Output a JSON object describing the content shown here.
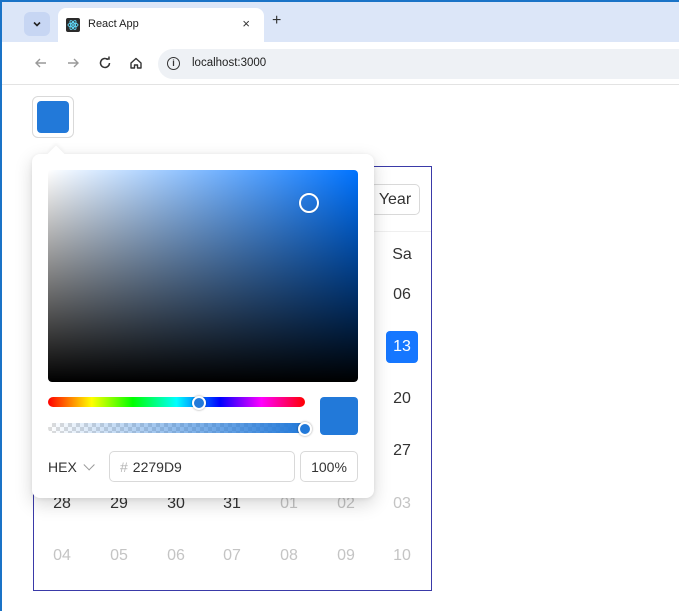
{
  "browser": {
    "tab_title": "React App",
    "tab_close": "×",
    "new_tab": "+",
    "url": "localhost:3000",
    "info_glyph": "i"
  },
  "color_picker": {
    "value_hex": "#2279D9",
    "format": "HEX",
    "hex_prefix": "#",
    "hex_value": "2279D9",
    "alpha": "100%"
  },
  "calendar": {
    "year_button": "Year",
    "weekday_visible": "Sa",
    "cells": [
      {
        "text": "06",
        "state": "cur"
      },
      {
        "text": "13",
        "state": "sel"
      },
      {
        "text": "20",
        "state": "cur"
      },
      {
        "text": "27",
        "state": "cur"
      },
      {
        "text": "28",
        "state": "cur"
      },
      {
        "text": "29",
        "state": "cur"
      },
      {
        "text": "30",
        "state": "cur"
      },
      {
        "text": "31",
        "state": "cur"
      },
      {
        "text": "01",
        "state": "off"
      },
      {
        "text": "02",
        "state": "off"
      },
      {
        "text": "03",
        "state": "off"
      },
      {
        "text": "04",
        "state": "off"
      },
      {
        "text": "05",
        "state": "off"
      },
      {
        "text": "06",
        "state": "off"
      },
      {
        "text": "07",
        "state": "off"
      },
      {
        "text": "08",
        "state": "off"
      },
      {
        "text": "09",
        "state": "off"
      },
      {
        "text": "10",
        "state": "off"
      }
    ]
  },
  "icons": [
    "chevron-down-icon",
    "react-favicon-icon",
    "close-icon",
    "plus-icon",
    "back-icon",
    "forward-icon",
    "reload-icon",
    "home-icon",
    "info-icon"
  ]
}
